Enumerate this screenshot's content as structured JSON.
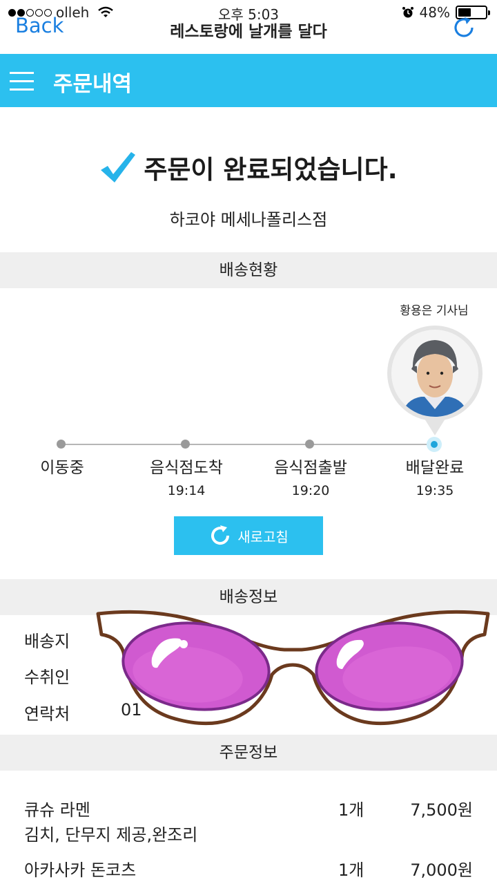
{
  "status_bar": {
    "carrier": "olleh",
    "time": "오후 5:03",
    "battery": "48%",
    "battery_level": 0.48
  },
  "nav": {
    "back_label": "Back",
    "title": "레스토랑에 날개를 달다"
  },
  "header": {
    "title": "주문내역"
  },
  "completion": {
    "message": "주문이 완료되었습니다.",
    "store": "하코야 메세나폴리스점"
  },
  "delivery_status": {
    "section_title": "배송현황",
    "driver_label": "황용은 기사님",
    "steps": [
      {
        "label": "이동중",
        "time": ""
      },
      {
        "label": "음식점도착",
        "time": "19:14"
      },
      {
        "label": "음식점출발",
        "time": "19:20"
      },
      {
        "label": "배달완료",
        "time": "19:35"
      }
    ],
    "active_step": "배달완료",
    "refresh_label": "새로고침"
  },
  "delivery_info": {
    "section_title": "배송정보",
    "rows": [
      {
        "label": "배송지",
        "value": ""
      },
      {
        "label": "수취인",
        "value": ""
      },
      {
        "label": "연락처",
        "value": "01"
      }
    ]
  },
  "order_info": {
    "section_title": "주문정보",
    "items": [
      {
        "name": "큐슈 라멘",
        "option": "김치, 단무지 제공,완조리",
        "qty": "1개",
        "price": "7,500원"
      },
      {
        "name": "아카사카 돈코츠",
        "option": "",
        "qty": "1개",
        "price": "7,000원"
      }
    ]
  },
  "colors": {
    "accent": "#2cc0ef",
    "ios_blue": "#1a7fe0",
    "section_bg": "#efefef",
    "glasses_lens": "#d05ad0"
  }
}
